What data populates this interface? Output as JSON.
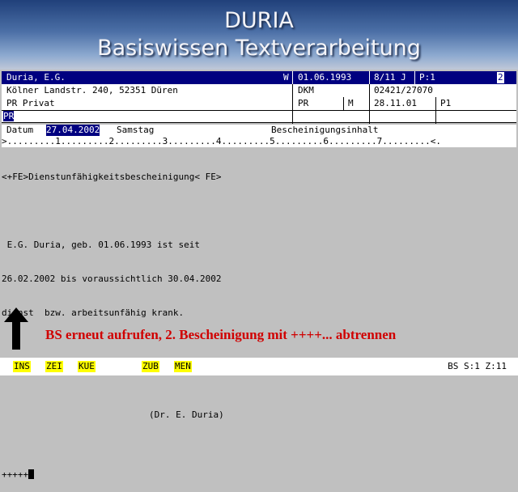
{
  "banner": {
    "title": "DURIA",
    "subtitle": "Basiswissen Textverarbeitung"
  },
  "patient": {
    "name": "Duria, E.G.",
    "sex_flag": "W",
    "birth_date": "01.06.1993",
    "age": "8/11 J",
    "page": "P:1",
    "index": "2",
    "address": "Kölner Landstr. 240, 52351 Düren",
    "insurance": "DKM",
    "phone": "02421/27070",
    "status": "PR Privat",
    "status_code": "PR",
    "m_flag": "M",
    "visit_date": "28.11.01",
    "p_flag": "P1",
    "input_value": "PR"
  },
  "dateline": {
    "label": "Datum",
    "date": "27.04.2002",
    "weekday": "Samstag",
    "section": "Bescheinigungsinhalt"
  },
  "ruler": ">.........1.........2.........3.........4.........5.........6.........7.........<.",
  "document": {
    "tag_line": "<+FE>Dienstunfähigkeitsbescheinigung< FE>",
    "line1": " E.G. Duria, geb. 01.06.1993 ist seit",
    "line2": "26.02.2002 bis voraussichtlich 30.04.2002",
    "line3": "dienst  bzw. arbeitsunfähig krank.",
    "signature": "(Dr. E. Duria)",
    "separator": "+++++"
  },
  "annotation": {
    "text": "BS erneut aufrufen, 2. Bescheinigung mit ++++... abtrennen"
  },
  "function_keys": [
    "INS",
    "ZEI",
    "KUE",
    "ZUB",
    "MEN"
  ],
  "statusbar": {
    "text": "BS S:1 Z:11"
  },
  "colors": {
    "header_bar": "#000080",
    "key_highlight": "#ffff00",
    "annotation_red": "#d00000"
  }
}
